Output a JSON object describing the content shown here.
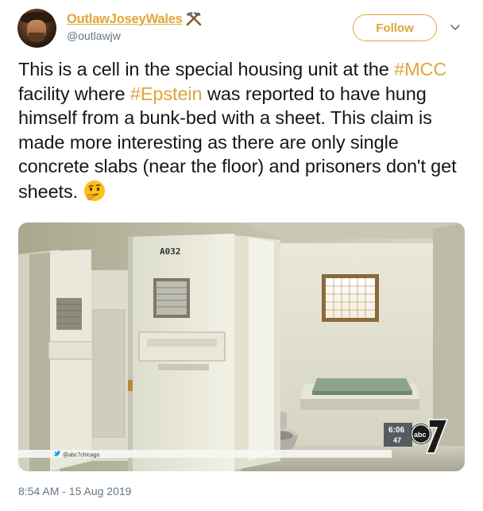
{
  "user": {
    "display_name": "OutlawJoseyWales",
    "handle": "@outlawjw",
    "name_icon": "hammer-and-pick-icon",
    "avatar": "avatar-image"
  },
  "follow_button": {
    "label": "Follow"
  },
  "menu": {
    "icon": "chevron-down-icon"
  },
  "tweet": {
    "text_1": "This is a cell in the special housing unit at the ",
    "hashtag_1": "#MCC",
    "text_2": " facility where ",
    "hashtag_2": "#Epstein",
    "text_3": " was reported to have hung himself from a bunk-bed with a sheet.  This claim is made more interesting as there are only single concrete slabs (near the floor) and prisoners don't get sheets.",
    "emoji": "thinking-face-emoji"
  },
  "media": {
    "door_number": "A032",
    "broadcast_time": "6:06",
    "broadcast_temp": "47",
    "channel_logo": "abc",
    "channel_number": "7",
    "watermark_handle": "@abc7chicago"
  },
  "timestamp": "8:54 AM - 15 Aug 2019",
  "colors": {
    "accent": "#e0a53a",
    "text": "#14171a",
    "secondary_text": "#657786"
  }
}
